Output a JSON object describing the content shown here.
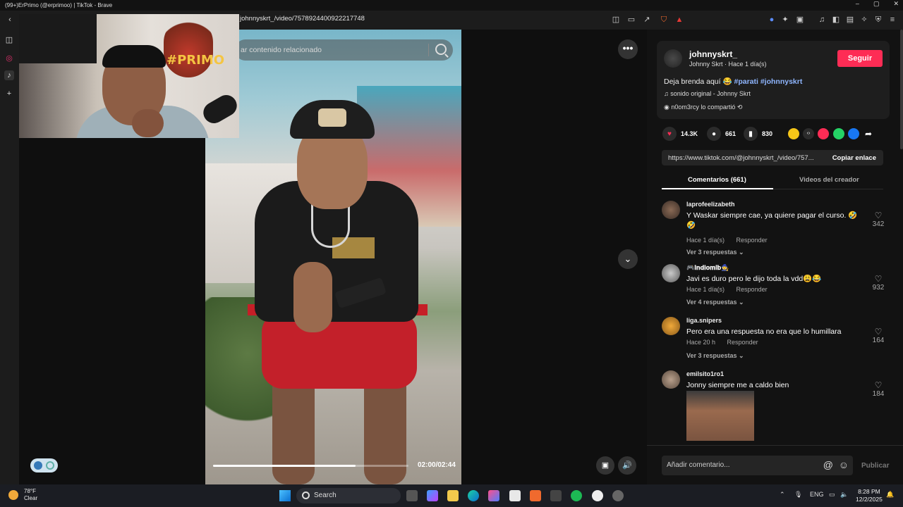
{
  "window": {
    "title": "(99+)ErPrimo (@erprimoo) | TikTok - Brave",
    "controls": [
      "–",
      "▢",
      "✕"
    ]
  },
  "toolbar": {
    "url": "johnnyskrt_/video/7578924400922217748"
  },
  "video": {
    "search_placeholder": "ar contenido relacionado",
    "time": "02:00/02:44",
    "progress": 0.73
  },
  "webcam": {
    "logo_text": "#PRIMO"
  },
  "panel": {
    "username": "johnnyskrt_",
    "subtitle": "Johnny Skrt · Hace 1 día(s)",
    "follow_label": "Seguir",
    "description_text": "Deja brenda aquí 😂",
    "tags": "#parati #johnnyskrt",
    "sound": "sonido original - Johnny Skrt",
    "shared": "n0om3rcy lo compartió",
    "likes": "14.3K",
    "comments_count": "661",
    "saves": "830",
    "link_url": "https://www.tiktok.com/@johnnyskrt_/video/757...",
    "copy_label": "Copiar enlace",
    "tab_comments": "Comentarios (661)",
    "tab_creator": "Videos del creador",
    "add_comment_placeholder": "Añadir comentario...",
    "publish_label": "Publicar"
  },
  "comments": [
    {
      "user": "laprofeelizabeth",
      "text": "Y Waskar siempre cae, ya quiere pagar el curso. 🤣🤣",
      "time": "Hace 1 día(s)",
      "reply": "Responder",
      "replies": "Ver 3 respuestas ⌄",
      "likes": "342"
    },
    {
      "user": "🎮𝐈𝐧𝐝𝐢𝐨𝐦𝐥𝐛🧙",
      "text": "Javi es duro pero le dijo toda la vdd😩😂",
      "time": "Hace 1 día(s)",
      "reply": "Responder",
      "replies": "Ver 4 respuestas ⌄",
      "likes": "932"
    },
    {
      "user": "liga.snipers",
      "text": "Pero era una respuesta no era que lo humillara",
      "time": "Hace 20 h",
      "reply": "Responder",
      "replies": "Ver 3 respuestas ⌄",
      "likes": "164"
    },
    {
      "user": "emilsito1ro1",
      "text": "Jonny siempre me a caldo bien",
      "likes": "184"
    }
  ],
  "taskbar": {
    "temp": "78°F",
    "weather": "Clear",
    "search": "Search",
    "lang": "ENG",
    "time": "8:28 PM",
    "date": "12/2/2025"
  },
  "colors": {
    "accent": "#fe2c55",
    "tag": "#8fb6ff"
  }
}
